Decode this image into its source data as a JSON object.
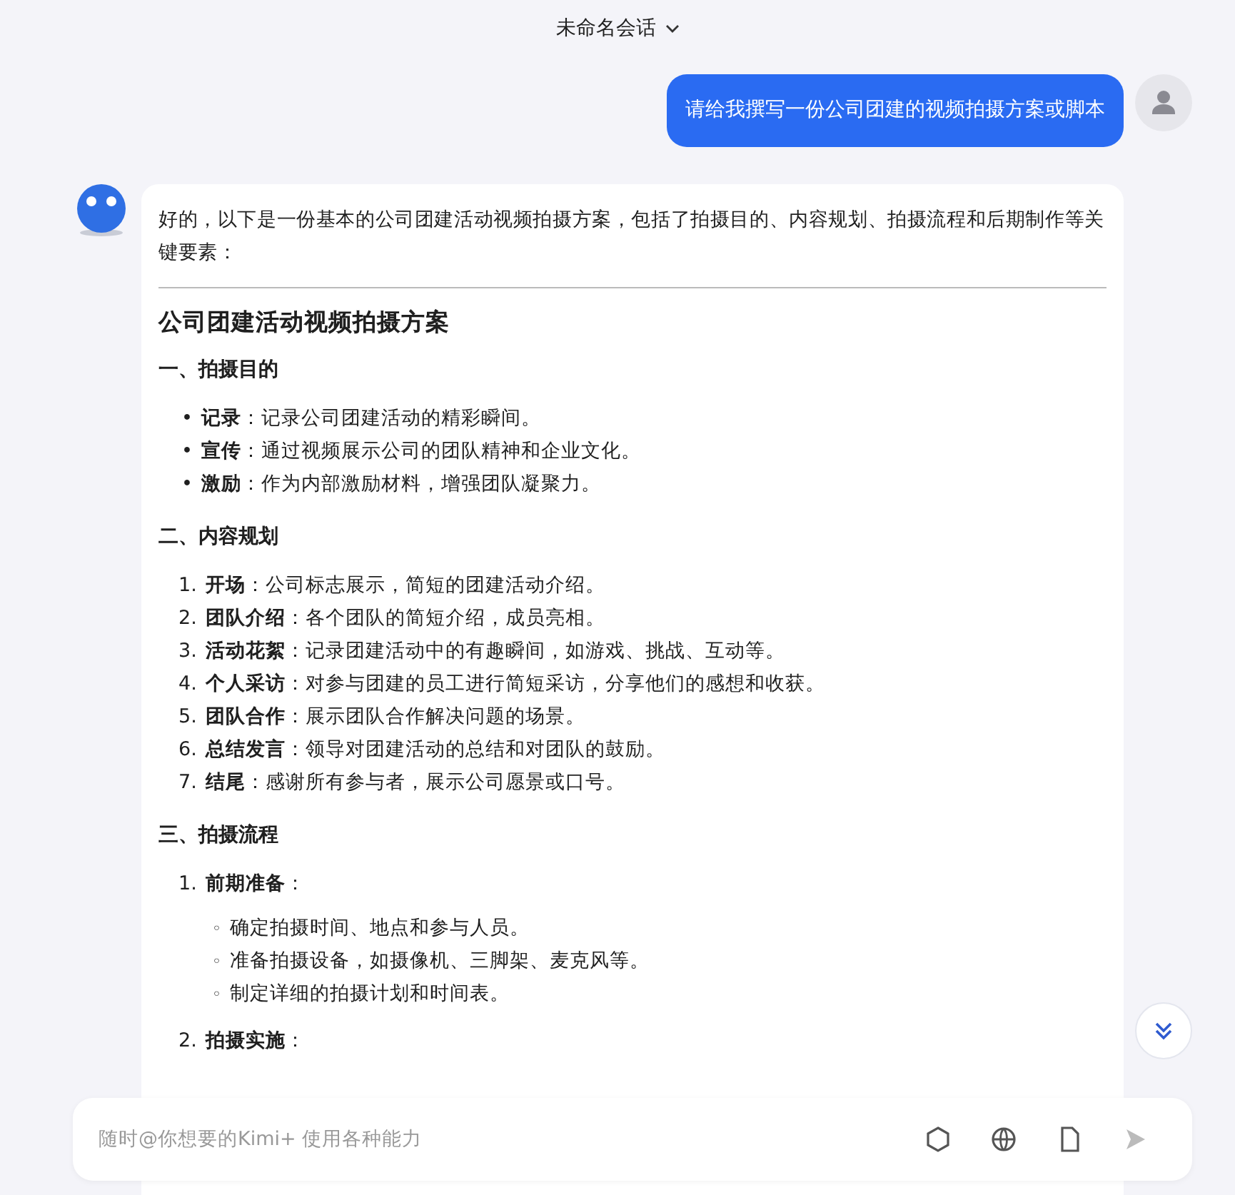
{
  "header": {
    "title": "未命名会话"
  },
  "user_message": {
    "text": "请给我撰写一份公司团建的视频拍摄方案或脚本"
  },
  "response": {
    "intro": "好的，以下是一份基本的公司团建活动视频拍摄方案，包括了拍摄目的、内容规划、拍摄流程和后期制作等关键要素：",
    "title": "公司团建活动视频拍摄方案",
    "sections": [
      {
        "heading": "一、拍摄目的",
        "items": [
          {
            "marker": "•",
            "text": "**记录**：记录公司团建活动的精彩瞬间。"
          },
          {
            "marker": "•",
            "text": "**宣传**：通过视频展示公司的团队精神和企业文化。"
          },
          {
            "marker": "•",
            "text": "**激励**：作为内部激励材料，增强团队凝聚力。"
          }
        ]
      },
      {
        "heading": "二、内容规划",
        "items": [
          {
            "marker": "1.",
            "text": "**开场**：公司标志展示，简短的团建活动介绍。"
          },
          {
            "marker": "2.",
            "text": "**团队介绍**：各个团队的简短介绍，成员亮相。"
          },
          {
            "marker": "3.",
            "text": "**活动花絮**：记录团建活动中的有趣瞬间，如游戏、挑战、互动等。"
          },
          {
            "marker": "4.",
            "text": "**个人采访**：对参与团建的员工进行简短采访，分享他们的感想和收获。"
          },
          {
            "marker": "5.",
            "text": "**团队合作**：展示团队合作解决问题的场景。"
          },
          {
            "marker": "6.",
            "text": "**总结发言**：领导对团建活动的总结和对团队的鼓励。"
          },
          {
            "marker": "7.",
            "text": "**结尾**：感谢所有参与者，展示公司愿景或口号。"
          }
        ]
      },
      {
        "heading": "三、拍摄流程",
        "items": [
          {
            "marker": "1.",
            "text": "**前期准备**：",
            "children": [
              {
                "marker": "◦",
                "text": "确定拍摄时间、地点和参与人员。"
              },
              {
                "marker": "◦",
                "text": "准备拍摄设备，如摄像机、三脚架、麦克风等。"
              },
              {
                "marker": "◦",
                "text": "制定详细的拍摄计划和时间表。"
              }
            ]
          },
          {
            "marker": "2.",
            "text": "**拍摄实施**："
          }
        ]
      }
    ]
  },
  "input": {
    "placeholder": "随时@你想要的Kimi+ 使用各种能力"
  }
}
